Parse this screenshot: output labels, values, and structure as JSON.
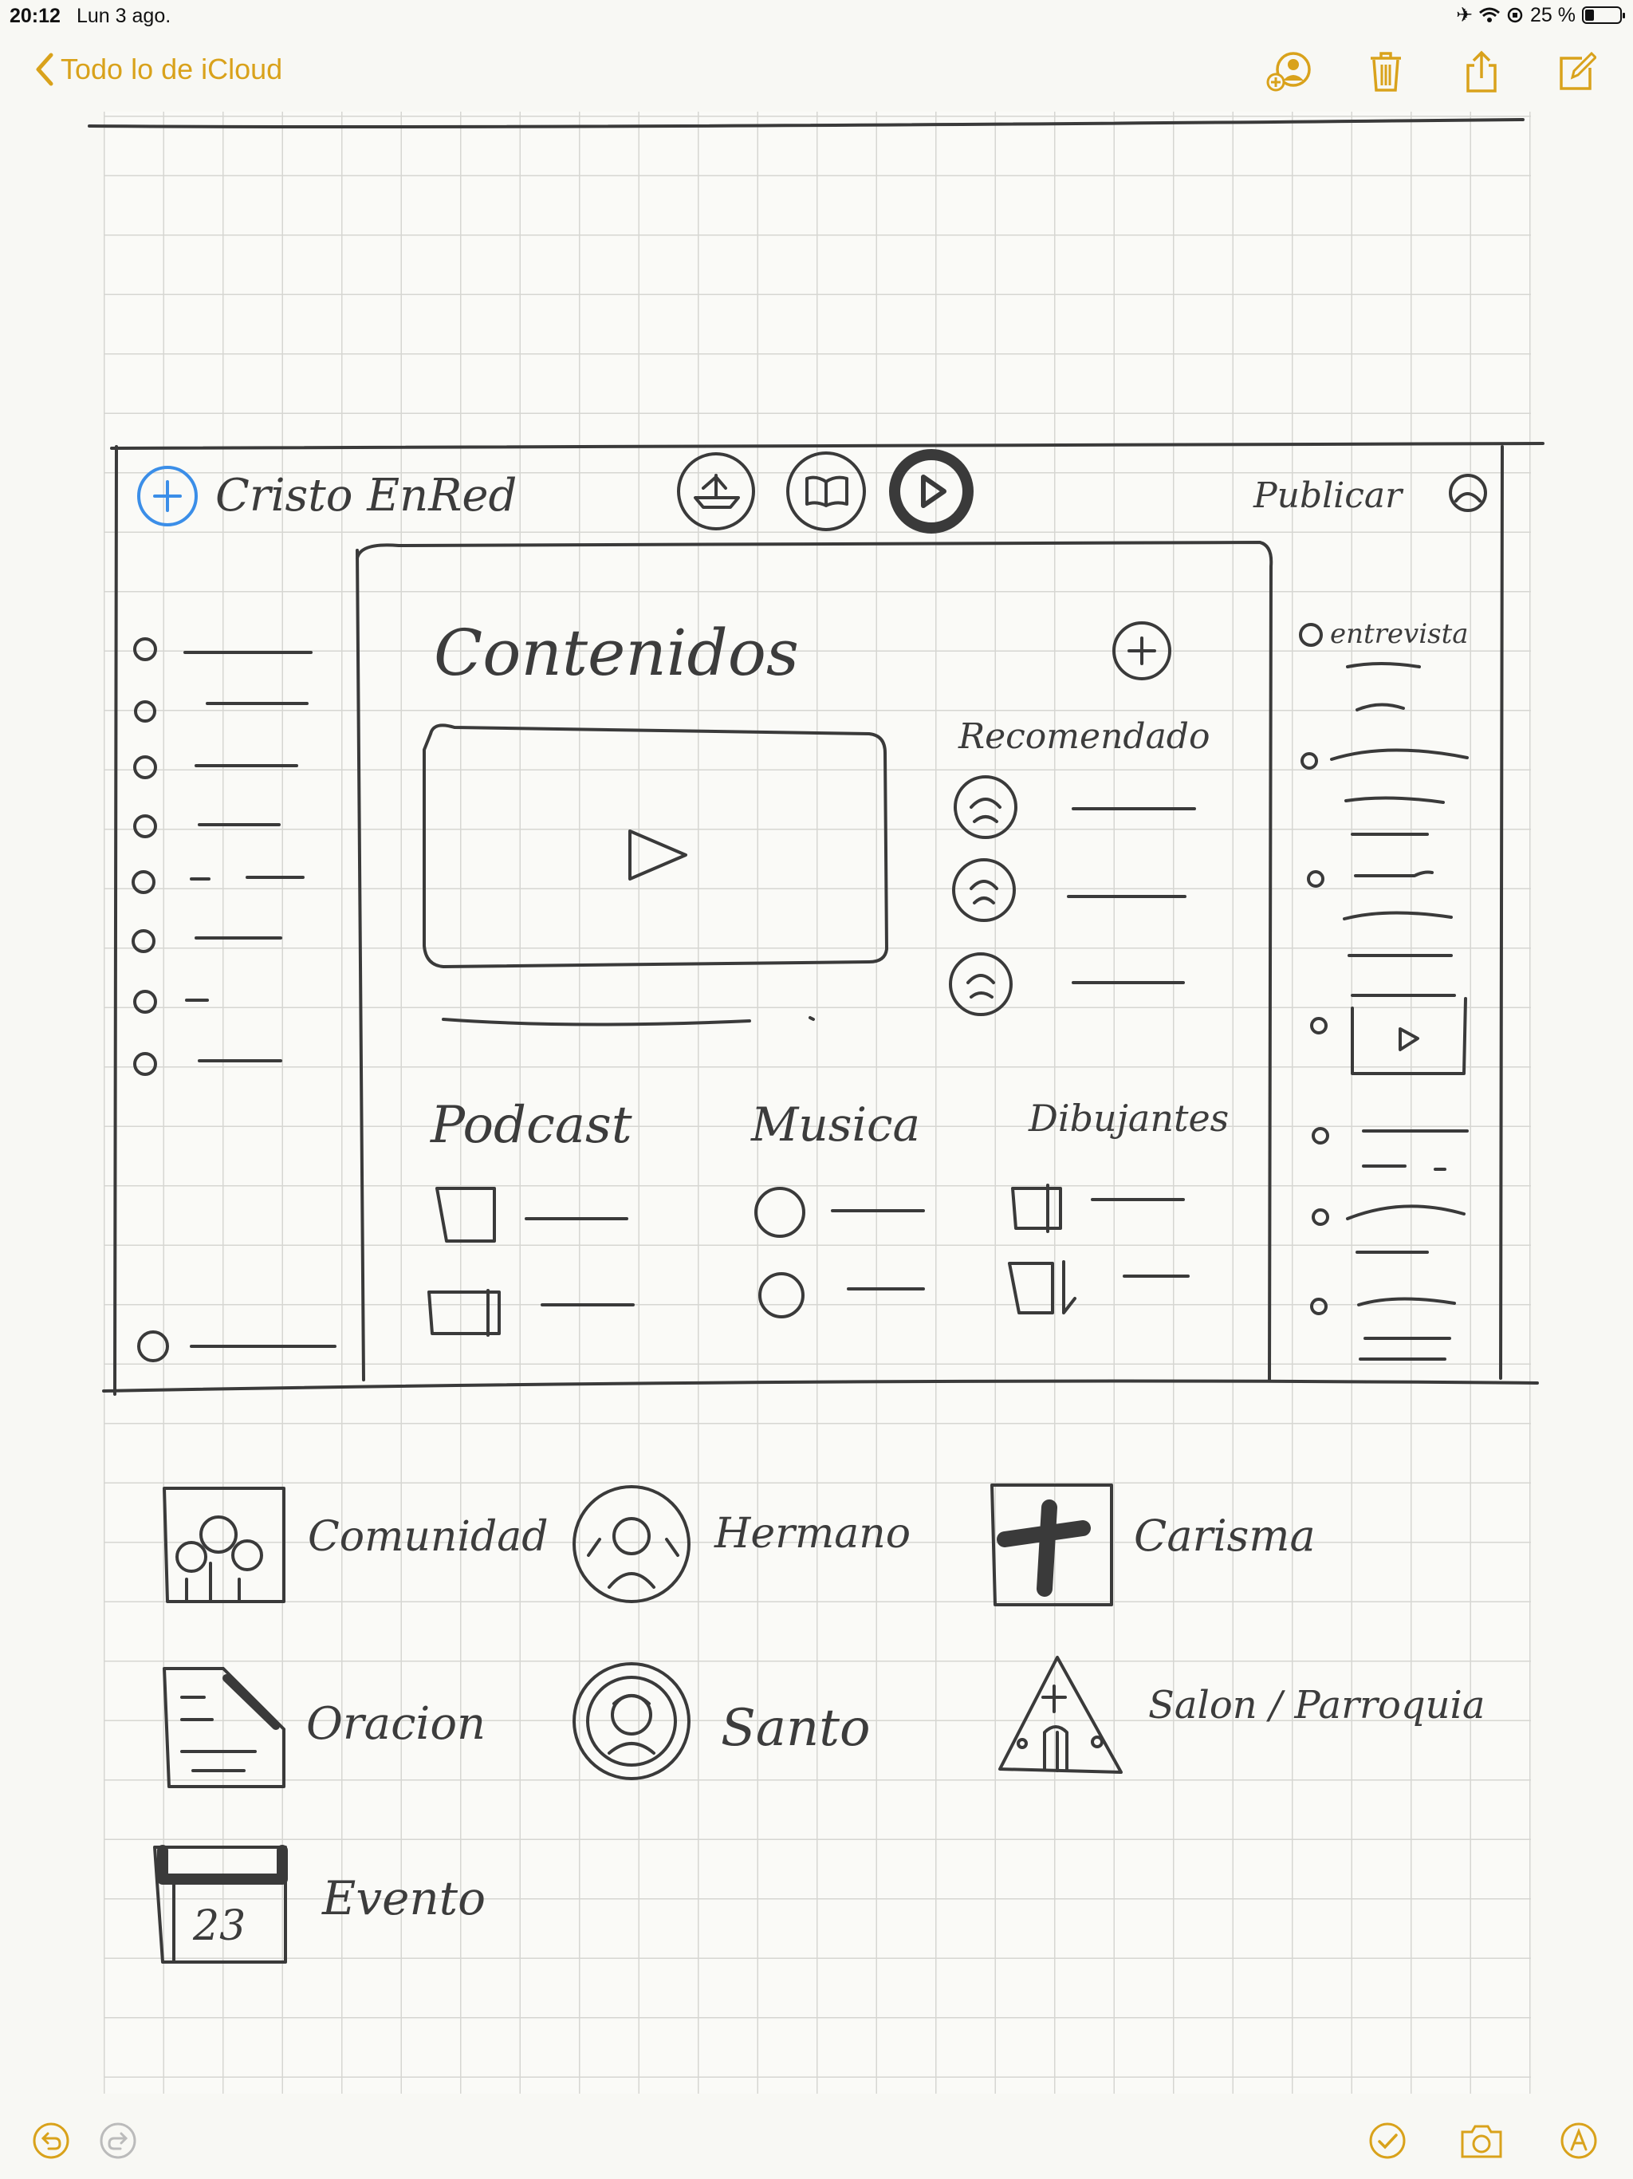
{
  "status_bar": {
    "time": "20:12",
    "date": "Lun 3 ago.",
    "battery_text": "25 %",
    "battery_level": 0.25
  },
  "nav": {
    "back_label": "Todo lo de iCloud",
    "accent_color": "#d9a21b",
    "actions": [
      "add-person-icon",
      "trash-icon",
      "share-icon",
      "compose-icon"
    ]
  },
  "sketch": {
    "app_title": "Cristo EnRed",
    "publish_label": "Publicar",
    "header_icons": [
      "ship-icon",
      "book-icon",
      "play-icon"
    ],
    "main_title": "Contenidos",
    "recommended_title": "Recomendado",
    "sections": [
      "Podcast",
      "Musica",
      "Dibujantes"
    ],
    "right_panel_first_label": "entrevista",
    "legend": [
      {
        "label": "Comunidad",
        "icon": "community-icon"
      },
      {
        "label": "Hermano",
        "icon": "brother-icon"
      },
      {
        "label": "Carisma",
        "icon": "cross-icon"
      },
      {
        "label": "Oracion",
        "icon": "prayer-document-icon"
      },
      {
        "label": "Santo",
        "icon": "saint-icon"
      },
      {
        "label": "Salon / Parroquia",
        "icon": "parish-icon"
      },
      {
        "label": "Evento",
        "icon": "calendar-icon"
      }
    ],
    "calendar_day": "23"
  },
  "toolbar": {
    "items": [
      "undo-icon",
      "redo-icon",
      "checklist-icon",
      "camera-icon",
      "markup-icon"
    ]
  }
}
